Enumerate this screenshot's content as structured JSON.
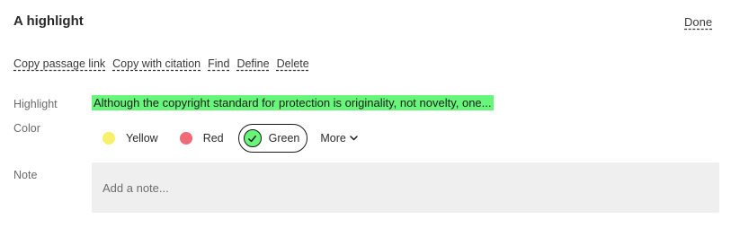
{
  "header": {
    "title": "A highlight",
    "done_label": "Done"
  },
  "actions": [
    {
      "label": "Copy passage link"
    },
    {
      "label": "Copy with citation"
    },
    {
      "label": "Find"
    },
    {
      "label": "Define"
    },
    {
      "label": "Delete"
    }
  ],
  "highlight": {
    "label": "Highlight",
    "text": "Although the copyright standard for protection is originality, not novelty, one...",
    "color": "#67f57a"
  },
  "color": {
    "label": "Color",
    "options": [
      {
        "label": "Yellow",
        "color": "#f7f06a",
        "selected": false
      },
      {
        "label": "Red",
        "color": "#f06b77",
        "selected": false
      },
      {
        "label": "Green",
        "color": "#67f57a",
        "selected": true
      }
    ],
    "more_label": "More"
  },
  "note": {
    "label": "Note",
    "placeholder": "Add a note..."
  }
}
